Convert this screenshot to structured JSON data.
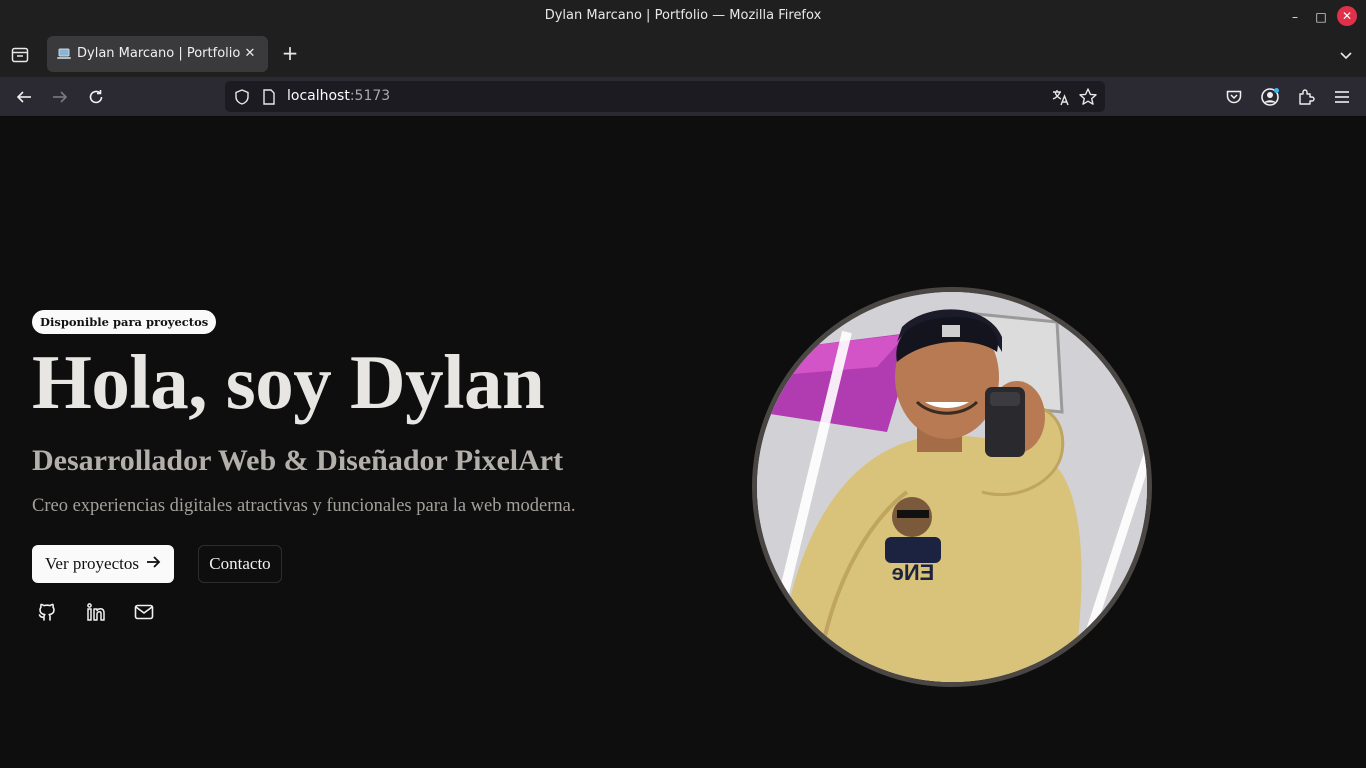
{
  "window": {
    "title": "Dylan Marcano | Portfolio — Mozilla Firefox",
    "minimize_glyph": "–",
    "maximize_glyph": "□",
    "close_glyph": "✕"
  },
  "tabs": [
    {
      "title": "Dylan Marcano | Portfolio",
      "favicon": "laptop-icon",
      "active": true
    }
  ],
  "tabbar": {
    "new_tab_glyph": "+",
    "close_glyph": "✕"
  },
  "navbar": {
    "url_host": "localhost",
    "url_port": ":5173",
    "icons": [
      "back-icon",
      "forward-icon",
      "reload-icon",
      "shield-icon",
      "page-icon",
      "translate-icon",
      "star-icon",
      "pocket-icon",
      "account-icon",
      "extensions-icon",
      "menu-icon"
    ]
  },
  "hero": {
    "badge": "Disponible para proyectos",
    "title": "Hola, soy Dylan",
    "subtitle": "Desarrollador Web & Diseñador PixelArt",
    "description": "Creo experiencias digitales atractivas y funcionales para la web moderna.",
    "primary_button": "Ver proyectos",
    "secondary_button": "Contacto",
    "social_icons": [
      "github-icon",
      "linkedin-icon",
      "mail-icon"
    ]
  },
  "colors": {
    "page_bg": "#0e0e0e",
    "chrome_bg": "#1f1f1f",
    "navbar_bg": "#2b2a33",
    "close_button": "#e0304a",
    "portrait_border": "#4a4643"
  }
}
